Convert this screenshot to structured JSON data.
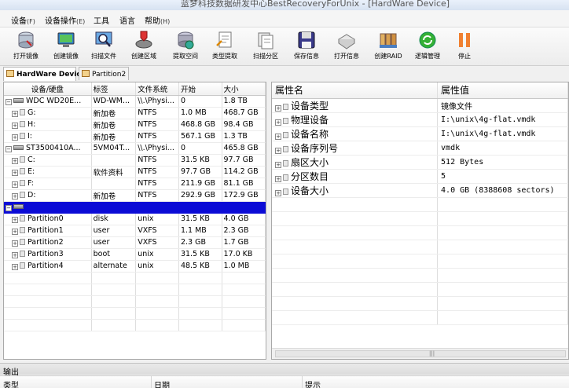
{
  "window": {
    "title": "蓝梦科技数据研发中心BestRecoveryForUnix - [HardWare Device]"
  },
  "menu": [
    {
      "label": "设备",
      "hotkey": "(F)"
    },
    {
      "label": "设备操作",
      "hotkey": "(E)"
    },
    {
      "label": "工具",
      "hotkey": ""
    },
    {
      "label": "语言",
      "hotkey": ""
    },
    {
      "label": "帮助",
      "hotkey": "(H)"
    }
  ],
  "toolbar": [
    {
      "label": "打开镜像",
      "icon": "disk-open-icon"
    },
    {
      "label": "创建镜像",
      "icon": "monitor-image-icon"
    },
    {
      "label": "扫描文件",
      "icon": "scan-file-icon"
    },
    {
      "label": "创建区域",
      "icon": "create-region-icon"
    },
    {
      "label": "提取空间",
      "icon": "extract-space-icon"
    },
    {
      "label": "类型提取",
      "icon": "type-extract-icon"
    },
    {
      "label": "扫描分区",
      "icon": "scan-partition-icon"
    },
    {
      "label": "保存信息",
      "icon": "save-icon"
    },
    {
      "label": "打开信息",
      "icon": "open-info-icon"
    },
    {
      "label": "创建RAID",
      "icon": "raid-icon"
    },
    {
      "label": "逻辑管理",
      "icon": "logic-manage-icon"
    },
    {
      "label": "停止",
      "icon": "stop-icon"
    }
  ],
  "tabs": [
    {
      "label": "HardWare Device",
      "active": true
    },
    {
      "label": "Partition2",
      "active": false
    }
  ],
  "device_table": {
    "headers": [
      "设备/硬盘",
      "标签",
      "文件系统",
      "开始",
      "大小"
    ],
    "rows": [
      {
        "level": 0,
        "expander": "⊟",
        "kind": "disk",
        "name": "WDC WD20E...",
        "label": "WD-WM...",
        "fs": "\\\\.\\Physi...",
        "start": "0",
        "size": "1.8 TB"
      },
      {
        "level": 1,
        "expander": "⊞",
        "kind": "part",
        "name": "G:",
        "label": "新加卷",
        "fs": "NTFS",
        "start": "1.0 MB",
        "size": "468.7 GB"
      },
      {
        "level": 1,
        "expander": "⊞",
        "kind": "part",
        "name": "H:",
        "label": "新加卷",
        "fs": "NTFS",
        "start": "468.8 GB",
        "size": "98.4 GB"
      },
      {
        "level": 1,
        "expander": "⊞",
        "kind": "part",
        "name": "I:",
        "label": "新加卷",
        "fs": "NTFS",
        "start": "567.1 GB",
        "size": "1.3 TB"
      },
      {
        "level": 0,
        "expander": "⊟",
        "kind": "disk",
        "name": "ST3500410A...",
        "label": "5VM04T...",
        "fs": "\\\\.\\Physi...",
        "start": "0",
        "size": "465.8 GB"
      },
      {
        "level": 1,
        "expander": "⊞",
        "kind": "part",
        "name": "C:",
        "label": "",
        "fs": "NTFS",
        "start": "31.5 KB",
        "size": "97.7 GB"
      },
      {
        "level": 1,
        "expander": "⊞",
        "kind": "part",
        "name": "E:",
        "label": "软件资料",
        "fs": "NTFS",
        "start": "97.7 GB",
        "size": "114.2 GB"
      },
      {
        "level": 1,
        "expander": "⊞",
        "kind": "part",
        "name": "F:",
        "label": "",
        "fs": "NTFS",
        "start": "211.9 GB",
        "size": "81.1 GB"
      },
      {
        "level": 1,
        "expander": "⊞",
        "kind": "part",
        "name": "D:",
        "label": "新加卷",
        "fs": "NTFS",
        "start": "292.9 GB",
        "size": "172.9 GB"
      },
      {
        "level": 0,
        "expander": "⊟",
        "kind": "disk",
        "name": "",
        "label": "",
        "fs": "",
        "start": "",
        "size": "",
        "selected": true
      },
      {
        "level": 1,
        "expander": "⊞",
        "kind": "part",
        "name": "Partition0",
        "label": "disk",
        "fs": "unix",
        "start": "31.5 KB",
        "size": "4.0 GB"
      },
      {
        "level": 1,
        "expander": "⊞",
        "kind": "part",
        "name": "Partition1",
        "label": "user",
        "fs": "VXFS",
        "start": "1.1 MB",
        "size": "2.3 GB"
      },
      {
        "level": 1,
        "expander": "⊞",
        "kind": "part",
        "name": "Partition2",
        "label": "user",
        "fs": "VXFS",
        "start": "2.3 GB",
        "size": "1.7 GB"
      },
      {
        "level": 1,
        "expander": "⊞",
        "kind": "part",
        "name": "Partition3",
        "label": "boot",
        "fs": "unix",
        "start": "31.5 KB",
        "size": "17.0 KB"
      },
      {
        "level": 1,
        "expander": "⊞",
        "kind": "part",
        "name": "Partition4",
        "label": "alternate",
        "fs": "unix",
        "start": "48.5 KB",
        "size": "1.0 MB"
      }
    ]
  },
  "property_table": {
    "headers": [
      "属性名",
      "属性值"
    ],
    "rows": [
      {
        "name": "设备类型",
        "value": "镜像文件"
      },
      {
        "name": "物理设备",
        "value": "I:\\unix\\4g-flat.vmdk"
      },
      {
        "name": "设备名称",
        "value": "I:\\unix\\4g-flat.vmdk"
      },
      {
        "name": "设备序列号",
        "value": "vmdk"
      },
      {
        "name": "扇区大小",
        "value": "512 Bytes"
      },
      {
        "name": "分区数目",
        "value": "5"
      },
      {
        "name": "设备大小",
        "value": "4.0 GB (8388608 sectors)"
      }
    ]
  },
  "output": {
    "title": "输出",
    "columns": [
      "类型",
      "日期",
      "提示"
    ]
  }
}
